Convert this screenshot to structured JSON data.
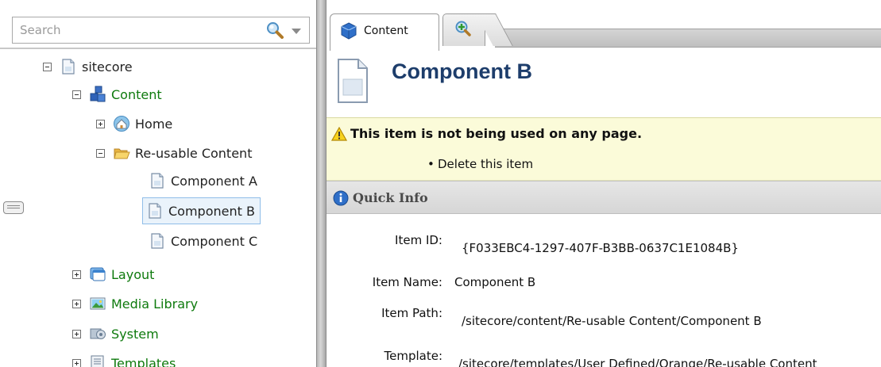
{
  "search": {
    "placeholder": "Search"
  },
  "tree": {
    "root": "sitecore",
    "content": "Content",
    "home": "Home",
    "reusable": "Re-usable Content",
    "component_a": "Component A",
    "component_b": "Component B",
    "component_c": "Component C",
    "layout": "Layout",
    "media_library": "Media Library",
    "system": "System",
    "templates": "Templates"
  },
  "tabs": {
    "content": "Content"
  },
  "item": {
    "title": "Component B"
  },
  "warning": {
    "message": "This item is not being used on any page.",
    "action": "Delete this item"
  },
  "quick_info": {
    "title": "Quick Info",
    "fields": [
      {
        "label": "Item ID:",
        "value": "{F033EBC4-1297-407F-B3BB-0637C1E1084B}"
      },
      {
        "label": "Item Name:",
        "value": "Component B"
      },
      {
        "label": "Item Path:",
        "value": "/sitecore/content/Re-usable Content/Component B"
      },
      {
        "label": "Template:",
        "value": "/sitecore/templates/User Defined/Orange/Re-usable Content"
      }
    ]
  },
  "colors": {
    "tree_green": "#0e7a0d",
    "title_blue": "#1d3d6b",
    "warning_bg": "#fbfbd9",
    "selection_border": "#8fbde8"
  }
}
